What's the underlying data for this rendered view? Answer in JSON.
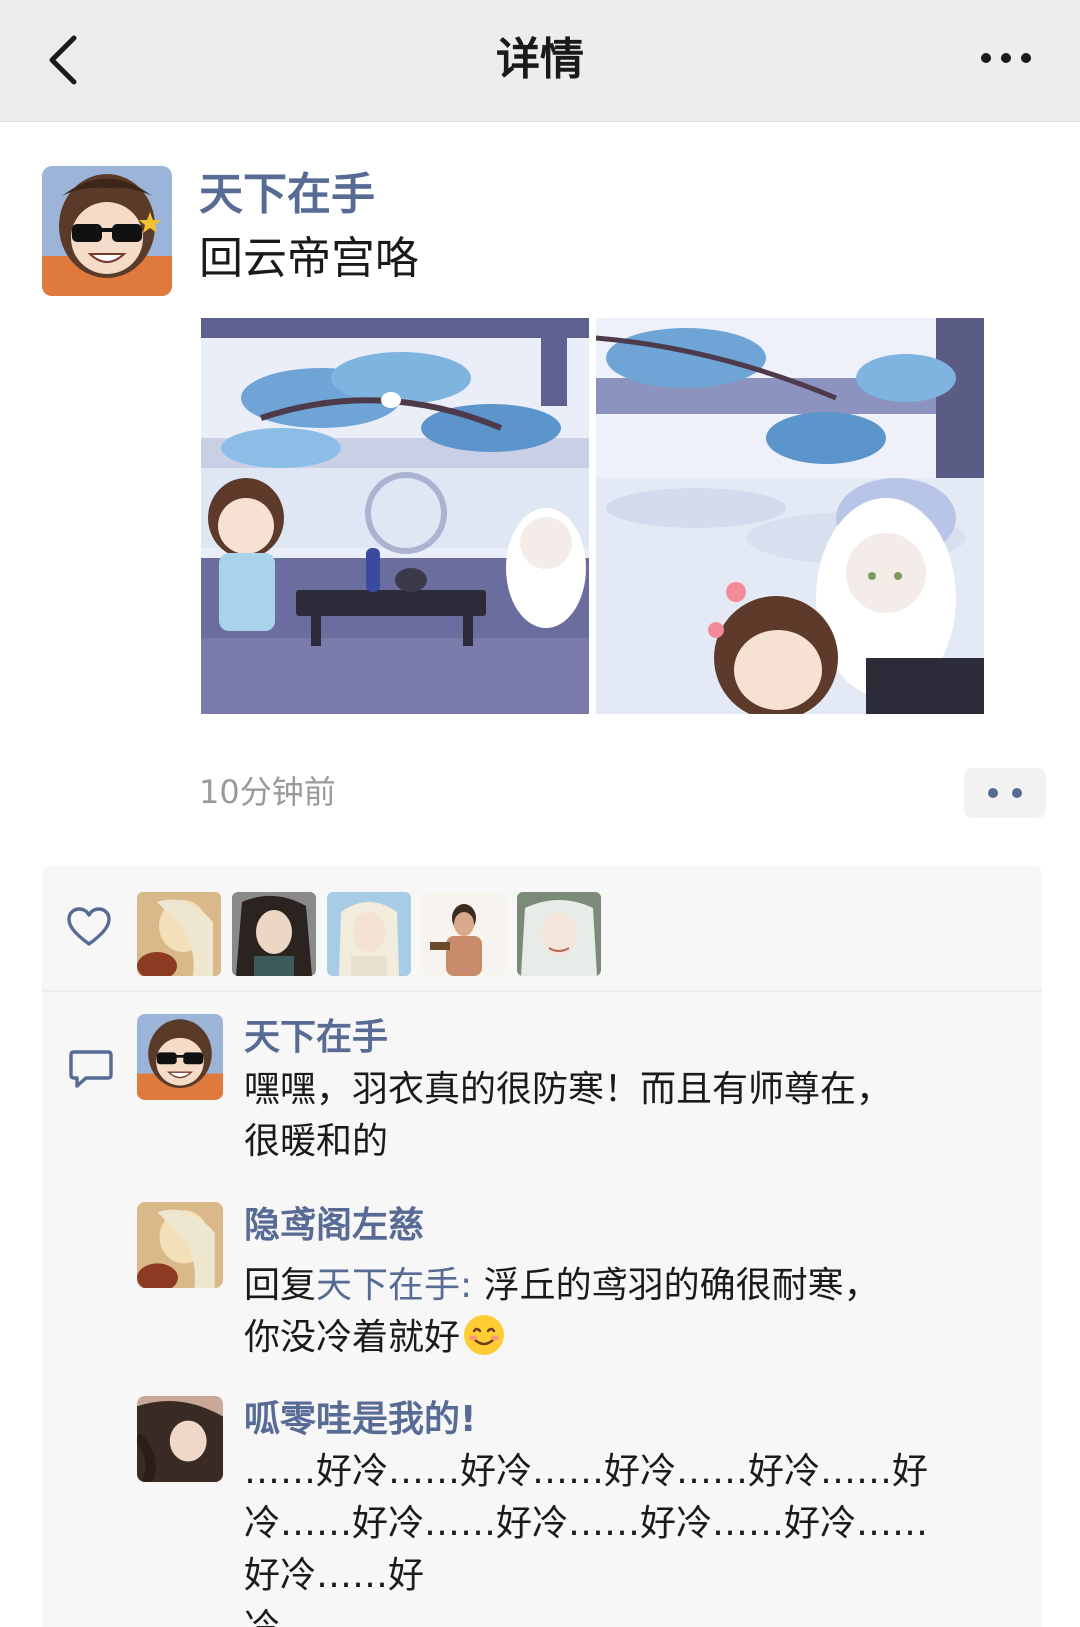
{
  "header": {
    "title": "详情",
    "back_icon": "back-chevron-icon",
    "more_icon": "more-dots-icon"
  },
  "post": {
    "author": "天下在手",
    "text": "回云帝宫咯",
    "time": "10分钟前",
    "images": [
      "snowy-courtyard-tea-image",
      "snowy-garden-characters-image"
    ]
  },
  "likes": {
    "icon": "heart-icon",
    "avatars": [
      "liker-avatar-1",
      "liker-avatar-2",
      "liker-avatar-3",
      "liker-avatar-4",
      "liker-avatar-5"
    ]
  },
  "comments": [
    {
      "name": "天下在手",
      "text_line1": "嘿嘿，羽衣真的很防寒！而且有师尊在，",
      "text_line2": "很暖和的"
    },
    {
      "name": "隐鸢阁左慈",
      "reply_prefix": "回复",
      "reply_target": "天下在手:",
      "text_line1": " 浮丘的鸢羽的确很耐寒，",
      "text_line2": "你没冷着就好",
      "emoji": "smiling-face-emoji"
    },
    {
      "name": "呱零哇是我的!",
      "text_line1": "……好冷……好冷……好冷……好冷……好",
      "text_line2": "冷……好冷……好冷……好冷……好冷……好冷……好",
      "text_line3": "冷……"
    }
  ],
  "colors": {
    "link": "#576b95",
    "header_bg": "#ededed",
    "panel_bg": "#f7f7f7"
  }
}
